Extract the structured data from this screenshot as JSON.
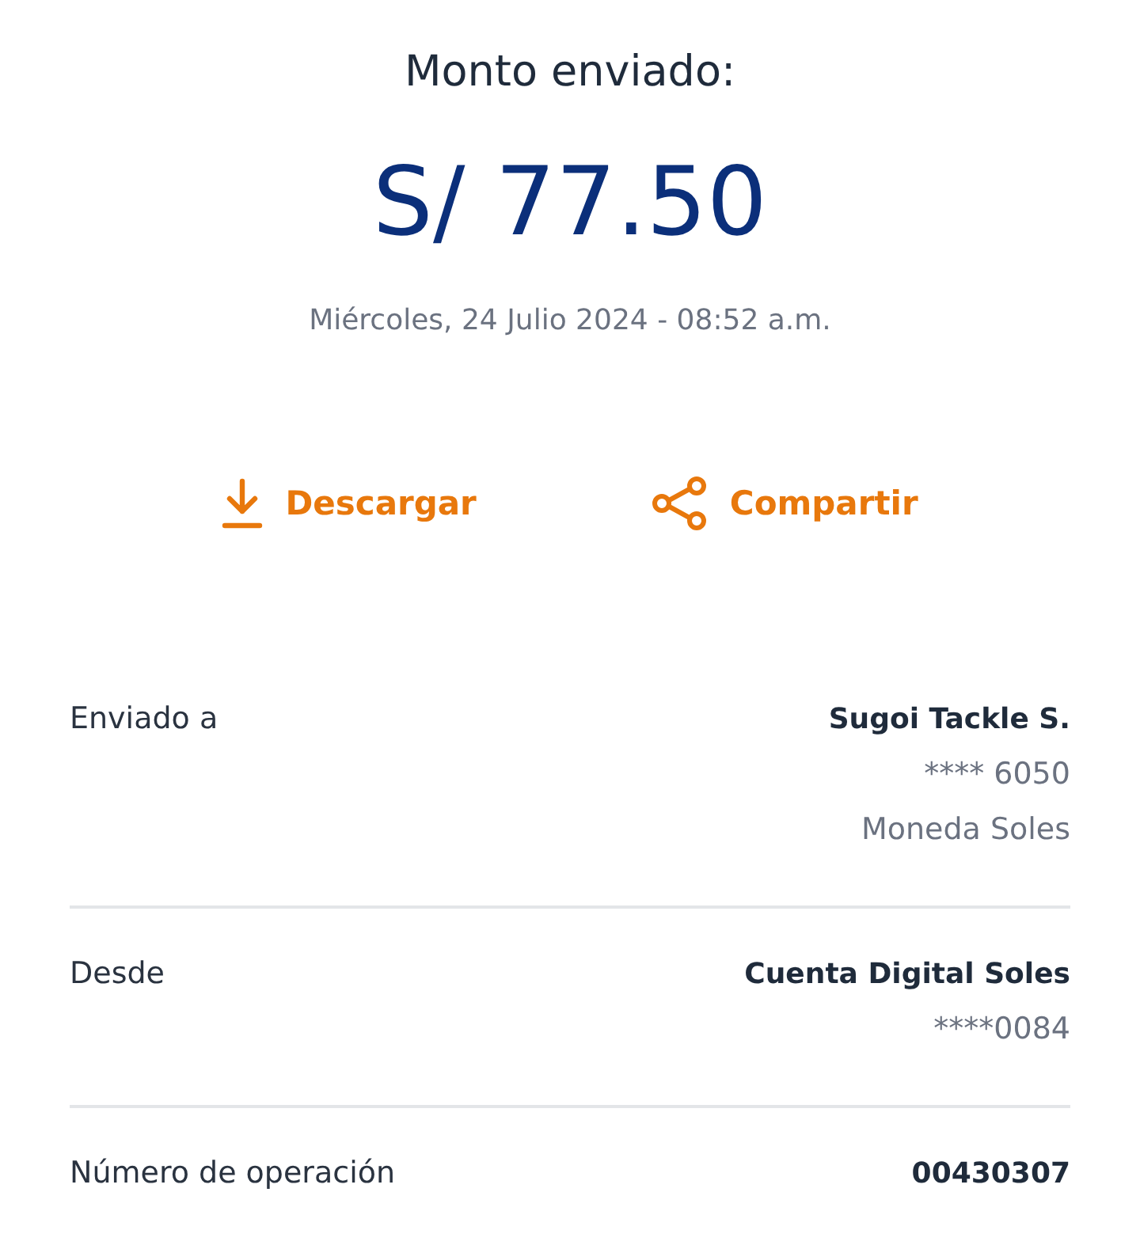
{
  "title": "Monto enviado:",
  "amount": "S/ 77.50",
  "date": "Miércoles, 24 Julio 2024 - 08:52 a.m.",
  "actions": [
    {
      "kind": "download",
      "label": "Descargar"
    },
    {
      "kind": "share",
      "label": "Compartir"
    }
  ],
  "details": [
    {
      "label": "Enviado a",
      "values": [
        {
          "text": "Sugoi Tackle S.",
          "bold": true
        },
        {
          "text": "**** 6050",
          "bold": false
        },
        {
          "text": "Moneda Soles",
          "bold": false
        }
      ]
    },
    {
      "label": "Desde",
      "values": [
        {
          "text": "Cuenta Digital Soles",
          "bold": true
        },
        {
          "text": "****0084",
          "bold": false
        }
      ]
    },
    {
      "label": "Número de operación",
      "values": [
        {
          "text": "00430307",
          "bold": true
        }
      ]
    }
  ]
}
